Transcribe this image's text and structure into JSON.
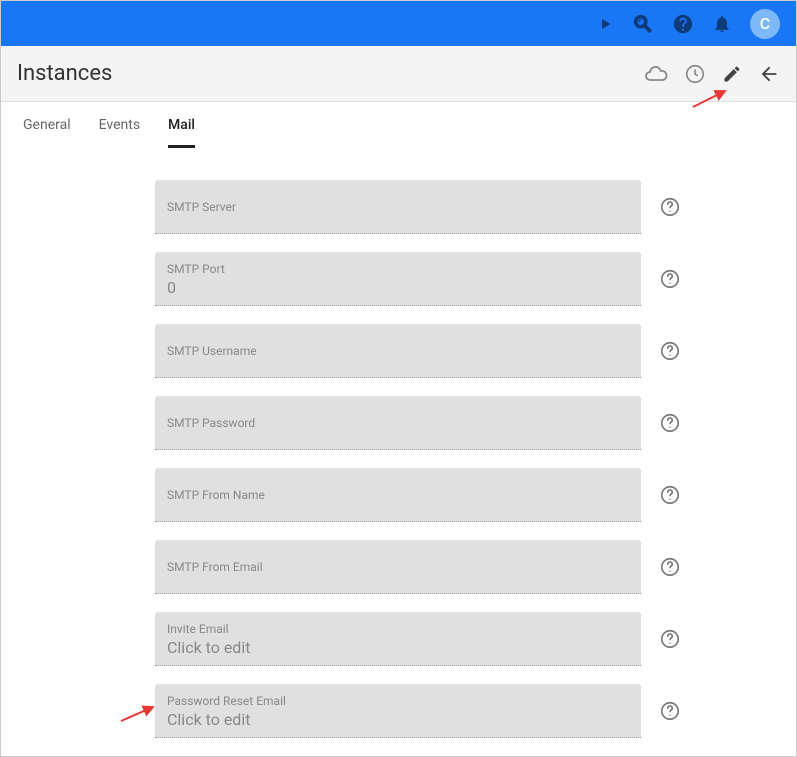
{
  "header": {
    "avatar_initial": "C"
  },
  "subheader": {
    "title": "Instances"
  },
  "tabs": [
    {
      "label": "General",
      "active": false
    },
    {
      "label": "Events",
      "active": false
    },
    {
      "label": "Mail",
      "active": true
    }
  ],
  "fields": [
    {
      "label": "SMTP Server",
      "value": ""
    },
    {
      "label": "SMTP Port",
      "value": "0"
    },
    {
      "label": "SMTP Username",
      "value": ""
    },
    {
      "label": "SMTP Password",
      "value": ""
    },
    {
      "label": "SMTP From Name",
      "value": ""
    },
    {
      "label": "SMTP From Email",
      "value": ""
    },
    {
      "label": "Invite Email",
      "value": "Click to edit"
    },
    {
      "label": "Password Reset Email",
      "value": "Click to edit"
    }
  ]
}
